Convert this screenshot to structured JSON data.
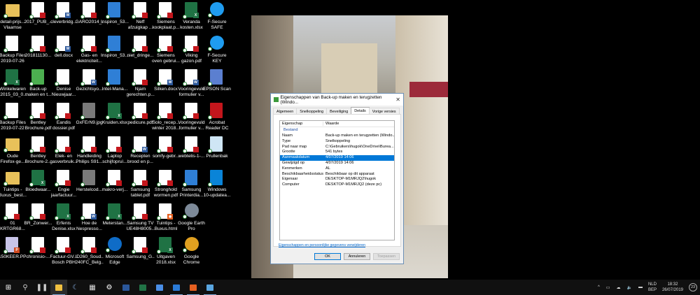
{
  "desktop": {
    "columns": [
      [
        {
          "l": "detail-prijs...\nVlaamse en...",
          "t": "folder"
        },
        {
          "l": "Backup Files\n2019-07-26 ...",
          "t": "doc"
        },
        {
          "l": "Winkelwaren\n(2015_03_0...",
          "t": "xlsx"
        },
        {
          "l": "Backup Files\n2019-07-22 ...",
          "t": "doc"
        },
        {
          "l": "Oude\nFirefox-ge...",
          "t": "folder"
        },
        {
          "l": "Tuintips -\nBuxus_best...",
          "t": "folder"
        },
        {
          "l": "01\nKRTGR68...",
          "t": "pdf"
        },
        {
          "l": "150KEER.PPS",
          "t": "ppt"
        }
      ],
      [
        {
          "l": "2017_PUB_...",
          "t": "pdf"
        },
        {
          "l": "201811130...",
          "t": "pdf"
        },
        {
          "l": "Back-up\nmaken en t...",
          "t": "backup"
        },
        {
          "l": "Bentley\nBrochure.pdf",
          "t": "pdf"
        },
        {
          "l": "Bentley\nBrochure-2...",
          "t": "pdf"
        },
        {
          "l": "Bloedwaar...",
          "t": "xlsx"
        },
        {
          "l": "BR_Zonwer...",
          "t": "pdf"
        },
        {
          "l": "chronisio-...",
          "t": "pdf"
        }
      ],
      [
        {
          "l": "cleverbridg...",
          "t": "docx"
        },
        {
          "l": "dell.docx",
          "t": "docx"
        },
        {
          "l": "Denise\nNieuwjaar...",
          "t": "doc"
        },
        {
          "l": "Eandis\ndossier.pdf",
          "t": "pdf"
        },
        {
          "l": "Elek- en\ngasverbruik...",
          "t": "pdf"
        },
        {
          "l": "Engie\njaarfactuur...",
          "t": "pdf"
        },
        {
          "l": "Erfenis\nDenise.xlsx",
          "t": "xlsx"
        },
        {
          "l": "Factuur-GV...\nBosch PBH ...",
          "t": "pdf"
        }
      ],
      [
        {
          "l": "GARO2014_...",
          "t": "pdf"
        },
        {
          "l": "Gas- en\nelektriciteit...",
          "t": "pdf"
        },
        {
          "l": "Gezichtsyo...",
          "t": "docx"
        },
        {
          "l": "GxFErN9.jpg",
          "t": "img"
        },
        {
          "l": "Handleiding\nPhilips S91...",
          "t": "pdf"
        },
        {
          "l": "Herstelcod...",
          "t": "img"
        },
        {
          "l": "Hoe de\nNespresso...",
          "t": "docx"
        },
        {
          "l": "ID260_Soud...\n240FC_Belg...",
          "t": "pdf"
        }
      ],
      [
        {
          "l": "Inspiron_53...",
          "t": "setup"
        },
        {
          "l": "Inspiron_53...",
          "t": "setup"
        },
        {
          "l": "Intel-Mana...",
          "t": "setup"
        },
        {
          "l": "Kruiden.xlsx",
          "t": "xlsx"
        },
        {
          "l": "Laptop\nschijfopruì...",
          "t": "pdf"
        },
        {
          "l": "makro-verj...",
          "t": "pdf"
        },
        {
          "l": "Meterstan...",
          "t": "xlsx"
        },
        {
          "l": "Microsoft\nEdge",
          "t": "edge"
        }
      ],
      [
        {
          "l": "Neff\nafzuigkap ...",
          "t": "pdf"
        },
        {
          "l": "niet_dringe...",
          "t": "pdf"
        },
        {
          "l": "Njam\ngerechten.p...",
          "t": "pdf"
        },
        {
          "l": "pedicure.pdf",
          "t": "pdf"
        },
        {
          "l": "Recepten\nbrood en p...",
          "t": "docx"
        },
        {
          "l": "Samsung\ntablet.pdf",
          "t": "pdf"
        },
        {
          "l": "Samsung TV\nUE48H8005...",
          "t": "pdf"
        },
        {
          "l": "Samsung_G...",
          "t": "pdf"
        }
      ],
      [
        {
          "l": "Siemens\nkookplaat.p...",
          "t": "pdf"
        },
        {
          "l": "Siemens\noven gebrui...",
          "t": "pdf"
        },
        {
          "l": "Silken.docx",
          "t": "docx"
        },
        {
          "l": "Solo_recep...\nwinter 2018...",
          "t": "pdf"
        },
        {
          "l": "somfy-gebr...",
          "t": "pdf"
        },
        {
          "l": "Stronghold\nwormen.pdf",
          "t": "pdf"
        },
        {
          "l": "Tuintips -\nBuxus.html",
          "t": "html"
        },
        {
          "l": "Uitgaven\n2018.xlsx",
          "t": "xlsx"
        }
      ],
      [
        {
          "l": "Veranda\nkosten.xlsx",
          "t": "xlsx"
        },
        {
          "l": "Viking\ngazon.pdf",
          "t": "pdf"
        },
        {
          "l": "Vooringevuld\nformulier v...",
          "t": "docx"
        },
        {
          "l": "Vooringevuld\nformulier v...",
          "t": "pdf"
        },
        {
          "l": "webtelis-1-...",
          "t": "pdf"
        },
        {
          "l": "Samsung\nPrinterdia...",
          "t": "setup"
        },
        {
          "l": "Google Earth\nPro",
          "t": "earth"
        },
        {
          "l": "Google\nChrome",
          "t": "chrome"
        }
      ],
      [
        {
          "l": "F-Secure\nSAFE",
          "t": "fsecure"
        },
        {
          "l": "F-Secure KEY",
          "t": "fsecure"
        },
        {
          "l": "EPSON Scan",
          "t": "scan"
        },
        {
          "l": "Acrobat\nReader DC",
          "t": "acrobat"
        },
        {
          "l": "Prullenbak",
          "t": "bin"
        },
        {
          "l": "Windows\n10-updatea...",
          "t": "windows"
        }
      ]
    ],
    "type_colors": {
      "folder": "#e8c15a",
      "doc": "#ffffff",
      "xlsx": "#1f7244",
      "pdf": "#ffffff",
      "ppt": "#c8c4e8",
      "backup": "#4caf50",
      "docx": "#ffffff",
      "img": "#7a7a7a",
      "setup": "#2f7fd6",
      "edge": "#0f6cc7",
      "html": "#ffffff",
      "earth": "#7d8a99",
      "chrome": "#e0a020",
      "fsecure": "#1f9cf0",
      "scan": "#5b7fd0",
      "acrobat": "#c4161c",
      "bin": "#cfe6f5",
      "windows": "#0a84d8"
    }
  },
  "dialog": {
    "title": "Eigenschappen van Back-up maken en terugzetten (Windo...",
    "close": "✕",
    "tabs": [
      "Algemeen",
      "Snelkoppeling",
      "Beveiliging",
      "Details",
      "Vorige versies"
    ],
    "active_tab": "Details",
    "col_property": "Eigenschap",
    "col_value": "Waarde",
    "group": "Bestand",
    "rows": [
      {
        "k": "Naam",
        "v": "Back-up maken en terugzetten (Windo..."
      },
      {
        "k": "Type",
        "v": "Snelkoppeling"
      },
      {
        "k": "Pad naar map",
        "v": "C:\\Gebruikers\\hugok\\OneDrive\\Burea..."
      },
      {
        "k": "Grootte",
        "v": "541 bytes"
      },
      {
        "k": "Aanmaakdatum",
        "v": "4/07/2019 14:06",
        "selected": true
      },
      {
        "k": "Gewijzigd op",
        "v": "4/07/2019 14:06"
      },
      {
        "k": "Kenmerken",
        "v": "AL"
      },
      {
        "k": "Beschikbaarheidsstatus",
        "v": "Beschikbaar op dit apparaat"
      },
      {
        "k": "Eigenaar",
        "v": "DESKTOP-M1MRJQ2\\hugok"
      },
      {
        "k": "Computer",
        "v": "DESKTOP-M1MRJQ2 (deze pc)"
      }
    ],
    "link": "Eigenschappen en persoonlijke gegevens verwijderen",
    "ok": "OK",
    "cancel": "Annuleren",
    "apply": "Toepassen"
  },
  "taskbar": {
    "apps": [
      {
        "n": "start-button",
        "g": "⊞",
        "c": "#fff"
      },
      {
        "n": "search-button",
        "g": "⚲",
        "c": "#ccc"
      },
      {
        "n": "task-view-button",
        "g": "❚❚",
        "c": "#ccc"
      },
      {
        "n": "file-explorer",
        "g": "",
        "c": "#f0c040",
        "active": true,
        "run": true
      },
      {
        "n": "backup-app",
        "g": "☾",
        "c": "#8ab4e8"
      },
      {
        "n": "calculator",
        "g": "▦",
        "c": "#ddd"
      },
      {
        "n": "settings",
        "g": "⚙",
        "c": "#fff"
      },
      {
        "n": "word",
        "g": "",
        "c": "#2b579a"
      },
      {
        "n": "excel",
        "g": "",
        "c": "#217346"
      },
      {
        "n": "calendar",
        "g": "",
        "c": "#4a8ee6"
      },
      {
        "n": "outlook",
        "g": "",
        "c": "#2a7ad6",
        "run": true
      },
      {
        "n": "firefox",
        "g": "",
        "c": "#e66020",
        "run": true
      },
      {
        "n": "photos",
        "g": "",
        "c": "#5aa6e0",
        "run": true
      }
    ],
    "tray_icons": [
      "^",
      "▭",
      "☁",
      "🔈",
      "▬"
    ],
    "language": "NLD",
    "keyboard": "BEP",
    "time": "18:32",
    "date": "26/07/2019",
    "notifications": "23"
  }
}
